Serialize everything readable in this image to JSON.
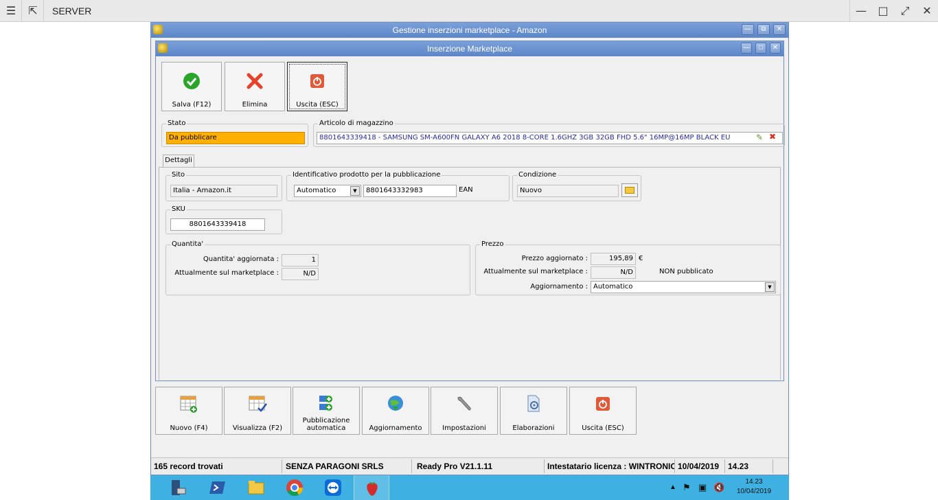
{
  "remote": {
    "title": "SERVER",
    "menu_icon": "hamburger-icon",
    "scale_icon": "scale-icon"
  },
  "outer_window": {
    "title": "Gestione inserzioni marketplace - Amazon"
  },
  "inner_window": {
    "title": "Inserzione Marketplace"
  },
  "toolbar": {
    "save_label": "Salva (F12)",
    "delete_label": "Elimina",
    "exit_label": "Uscita (ESC)"
  },
  "stato": {
    "group_label": "Stato",
    "value": "Da pubblicare"
  },
  "articolo": {
    "group_label": "Articolo di magazzino",
    "value": "8801643339418 - SAMSUNG SM-A600FN GALAXY A6 2018 8-CORE 1.6GHZ 3GB 32GB FHD 5.6\" 16MP@16MP BLACK EU"
  },
  "tabs": [
    {
      "label": "Dettagli"
    }
  ],
  "sito": {
    "group_label": "Sito",
    "value": "Italia - Amazon.it"
  },
  "identificativo": {
    "group_label": "Identificativo prodotto per la pubblicazione",
    "mode": "Automatico",
    "code": "8801643332983",
    "type": "EAN"
  },
  "condizione": {
    "group_label": "Condizione",
    "value": "Nuovo"
  },
  "sku": {
    "group_label": "SKU",
    "value": "8801643339418"
  },
  "quantita": {
    "group_label": "Quantita'",
    "updated_label": "Quantita' aggiornata :",
    "updated_value": "1",
    "market_label": "Attualmente sul marketplace :",
    "market_value": "N/D"
  },
  "prezzo": {
    "group_label": "Prezzo",
    "updated_label": "Prezzo aggiornato :",
    "updated_value": "195,89",
    "currency": "€",
    "market_label": "Attualmente sul marketplace :",
    "market_value": "N/D",
    "status": "NON pubblicato",
    "update_label": "Aggiornamento :",
    "update_value": "Automatico"
  },
  "bottom_buttons": [
    {
      "label": "Nuovo (F4)"
    },
    {
      "label": "Visualizza (F2)"
    },
    {
      "label": "Pubblicazione automatica"
    },
    {
      "label": "Aggiornamento"
    },
    {
      "label": "Impostazioni"
    },
    {
      "label": "Elaborazioni"
    },
    {
      "label": "Uscita (ESC)"
    }
  ],
  "statusbar": {
    "records": "165 record trovati",
    "company": "SENZA PARAGONI SRLS",
    "version": "Ready Pro V21.1.11",
    "license": "Intestatario licenza : WINTRONIC",
    "date": "10/04/2019",
    "time": "14.23"
  },
  "taskbar": {
    "clock_time": "14.23",
    "clock_date": "10/04/2019"
  },
  "colors": {
    "stato_bg": "#ffb000",
    "titlebar": "#6b93d1",
    "taskbar": "#3fb0e2"
  }
}
